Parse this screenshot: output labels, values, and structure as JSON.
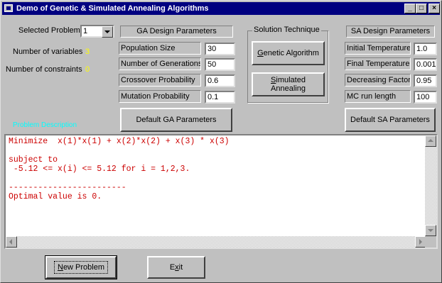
{
  "window": {
    "title": "Demo of Genetic & Simulated Annealing Algorithms"
  },
  "titlebar_buttons": {
    "minimize": "_",
    "maximize": "□",
    "close": "×"
  },
  "problem": {
    "selected_label": "Selected Problem",
    "selected_value": "1",
    "num_variables_label": "Number of variables",
    "num_variables_value": "3",
    "num_constraints_label": "Number of constraints",
    "num_constraints_value": "0",
    "description_link": "Problem Description"
  },
  "ga": {
    "header": "GA Design Parameters",
    "params": [
      {
        "label": "Population Size",
        "value": "30"
      },
      {
        "label": "Number of Generations",
        "value": "50"
      },
      {
        "label": "Crossover Probability",
        "value": "0.6"
      },
      {
        "label": "Mutation Probability",
        "value": "0.1"
      }
    ],
    "default_button": "Default GA Parameters"
  },
  "technique": {
    "legend": "Solution Technique",
    "ga_button_accel": "G",
    "ga_button_rest": "enetic Algorithm",
    "sa_button_accel": "S",
    "sa_button_rest": "imulated Annealing"
  },
  "sa": {
    "header": "SA Design Parameters",
    "params": [
      {
        "label": "Initial Temperature",
        "value": "1.0"
      },
      {
        "label": "Final Temperature",
        "value": "0.001"
      },
      {
        "label": "Decreasing Factor",
        "value": "0.95"
      },
      {
        "label": "MC run length",
        "value": "100"
      }
    ],
    "default_button": "Default SA Parameters"
  },
  "output": {
    "text": "Minimize  x(1)*x(1) + x(2)*x(2) + x(3) * x(3)\n\nsubject to\n -5.12 <= x(i) <= 5.12 for i = 1,2,3.\n\n------------------------\nOptimal value is 0."
  },
  "footer": {
    "new_problem_accel": "N",
    "new_problem_rest": "ew Problem",
    "exit_pre": "E",
    "exit_accel": "x",
    "exit_rest": "it"
  },
  "colors": {
    "title_bar": "#000080",
    "window_bg": "#c0c0c0",
    "value_yellow": "#ffff00",
    "link_cyan": "#00ffff",
    "output_text": "#cc0000"
  }
}
